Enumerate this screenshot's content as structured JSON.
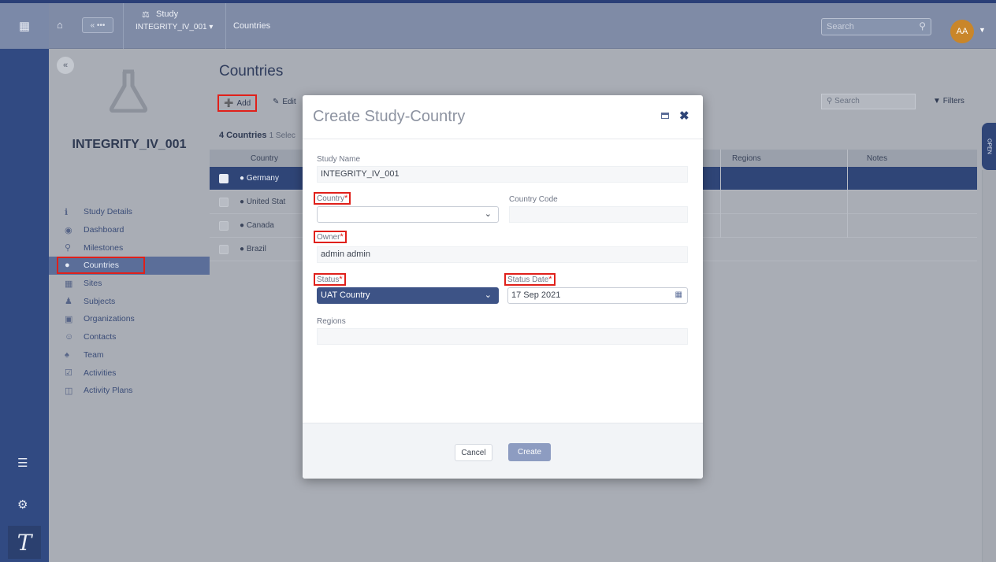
{
  "header": {
    "back_label": "« •••",
    "study_type": "Study",
    "study_selector": "INTEGRITY_IV_001",
    "breadcrumb": "Countries",
    "search_placeholder": "Search",
    "avatar_initials": "AA"
  },
  "nav": {
    "study_title": "INTEGRITY_IV_001",
    "items": [
      {
        "label": "Study Details",
        "icon": "info-icon"
      },
      {
        "label": "Dashboard",
        "icon": "dashboard-icon"
      },
      {
        "label": "Milestones",
        "icon": "pin-icon"
      },
      {
        "label": "Countries",
        "icon": "globe-icon"
      },
      {
        "label": "Sites",
        "icon": "building-icon"
      },
      {
        "label": "Subjects",
        "icon": "person-icon"
      },
      {
        "label": "Organizations",
        "icon": "organization-icon"
      },
      {
        "label": "Contacts",
        "icon": "contacts-icon"
      },
      {
        "label": "Team",
        "icon": "team-icon"
      },
      {
        "label": "Activities",
        "icon": "calendar-icon"
      },
      {
        "label": "Activity Plans",
        "icon": "plan-icon"
      }
    ]
  },
  "main": {
    "title": "Countries",
    "toolbar": {
      "add": "Add",
      "edit": "Edit",
      "search_placeholder": "Search",
      "filters": "Filters"
    },
    "count_label": "4 Countries",
    "selected_label": "1 Selec",
    "columns": {
      "country": "Country",
      "regions": "Regions",
      "notes": "Notes"
    },
    "rows": [
      "Germany",
      "United Stat",
      "Canada",
      "Brazil"
    ],
    "side_tab": "OPEN"
  },
  "modal": {
    "title": "Create Study-Country",
    "study_name_label": "Study Name",
    "study_name_value": "INTEGRITY_IV_001",
    "country_label": "Country",
    "country_value": "",
    "country_code_label": "Country Code",
    "country_code_value": "",
    "owner_label": "Owner",
    "owner_value": "admin admin",
    "status_label": "Status",
    "status_value": "UAT Country",
    "status_date_label": "Status Date",
    "status_date_value": "17 Sep 2021",
    "regions_label": "Regions",
    "regions_value": "",
    "required_mark": "*",
    "cancel": "Cancel",
    "create": "Create"
  },
  "colors": {
    "brand_dark": "#314a82",
    "selected_row": "#2f4577",
    "highlight_red": "#e0201a",
    "avatar": "#c9862a",
    "status_field": "#3d5386"
  }
}
